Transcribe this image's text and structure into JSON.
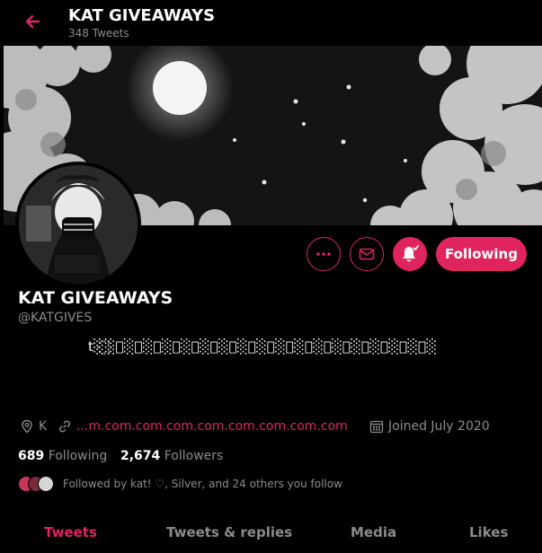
{
  "colors": {
    "accent": "#e0245e",
    "background": "#000000",
    "muted": "#8b8b8b"
  },
  "header": {
    "title": "KAT GIVEAWAYS",
    "tweet_count": "348 Tweets",
    "back_icon": "arrow-left-icon"
  },
  "actions": {
    "more_icon": "ellipsis-icon",
    "message_icon": "envelope-icon",
    "notify_icon": "bell-check-icon",
    "follow_label": "Following"
  },
  "profile": {
    "name": "KAT GIVEAWAYS",
    "handle": "@KATGIVES",
    "bio": "t░꙰░꙰░꙰░꙰░꙰░꙰░꙰░꙰░꙰░꙰░꙰░꙰░꙰░꙰░꙰░꙰░꙰░꙰░",
    "location": "K",
    "url": "...m.com.com.com.com.com.com.com.com",
    "joined": "Joined July 2020"
  },
  "stats": {
    "following_count": "689",
    "following_label": "Following",
    "followers_count": "2,674",
    "followers_label": "Followers"
  },
  "followed_by": "Followed by kat! ♡, Silver, and 24 others you follow",
  "tabs": [
    {
      "label": "Tweets",
      "active": true
    },
    {
      "label": "Tweets & replies",
      "active": false
    },
    {
      "label": "Media",
      "active": false
    },
    {
      "label": "Likes",
      "active": false
    }
  ]
}
